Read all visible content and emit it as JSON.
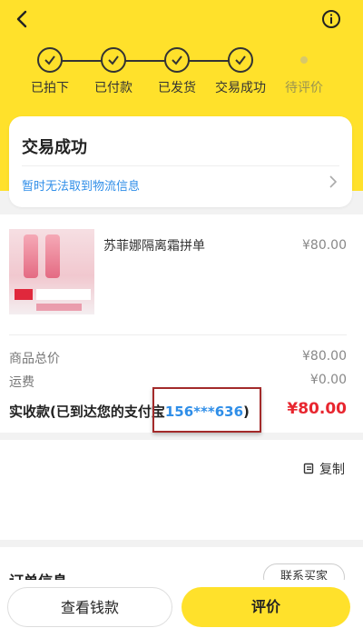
{
  "colors": {
    "brand_yellow": "#ffe12b",
    "link_blue": "#2f8ee8",
    "price_red": "#e8262f"
  },
  "header": {
    "back_icon": "chevron-left-icon",
    "info_icon": "info-circle-icon"
  },
  "progress": {
    "steps": [
      {
        "label": "已拍下",
        "done": true
      },
      {
        "label": "已付款",
        "done": true
      },
      {
        "label": "已发货",
        "done": true
      },
      {
        "label": "交易成功",
        "done": true
      },
      {
        "label": "待评价",
        "done": false
      }
    ]
  },
  "status": {
    "title": "交易成功",
    "logistics": "暂时无法取到物流信息"
  },
  "item": {
    "name": "苏菲娜隔离霜拼单",
    "price": "¥80.00"
  },
  "summary": {
    "total_label": "商品总价",
    "total_value": "¥80.00",
    "shipping_label": "运费",
    "shipping_value": "¥0.00",
    "paid_label_prefix": "实收款(已到达您的支付宝",
    "paid_account": "156***636",
    "paid_label_suffix": ")",
    "paid_value": "¥80.00"
  },
  "actions": {
    "copy_label": "复制"
  },
  "order_info": {
    "title": "订单信息",
    "contact_label": "联系买家"
  },
  "bottom": {
    "view_money_label": "查看钱款",
    "review_label": "评价"
  }
}
